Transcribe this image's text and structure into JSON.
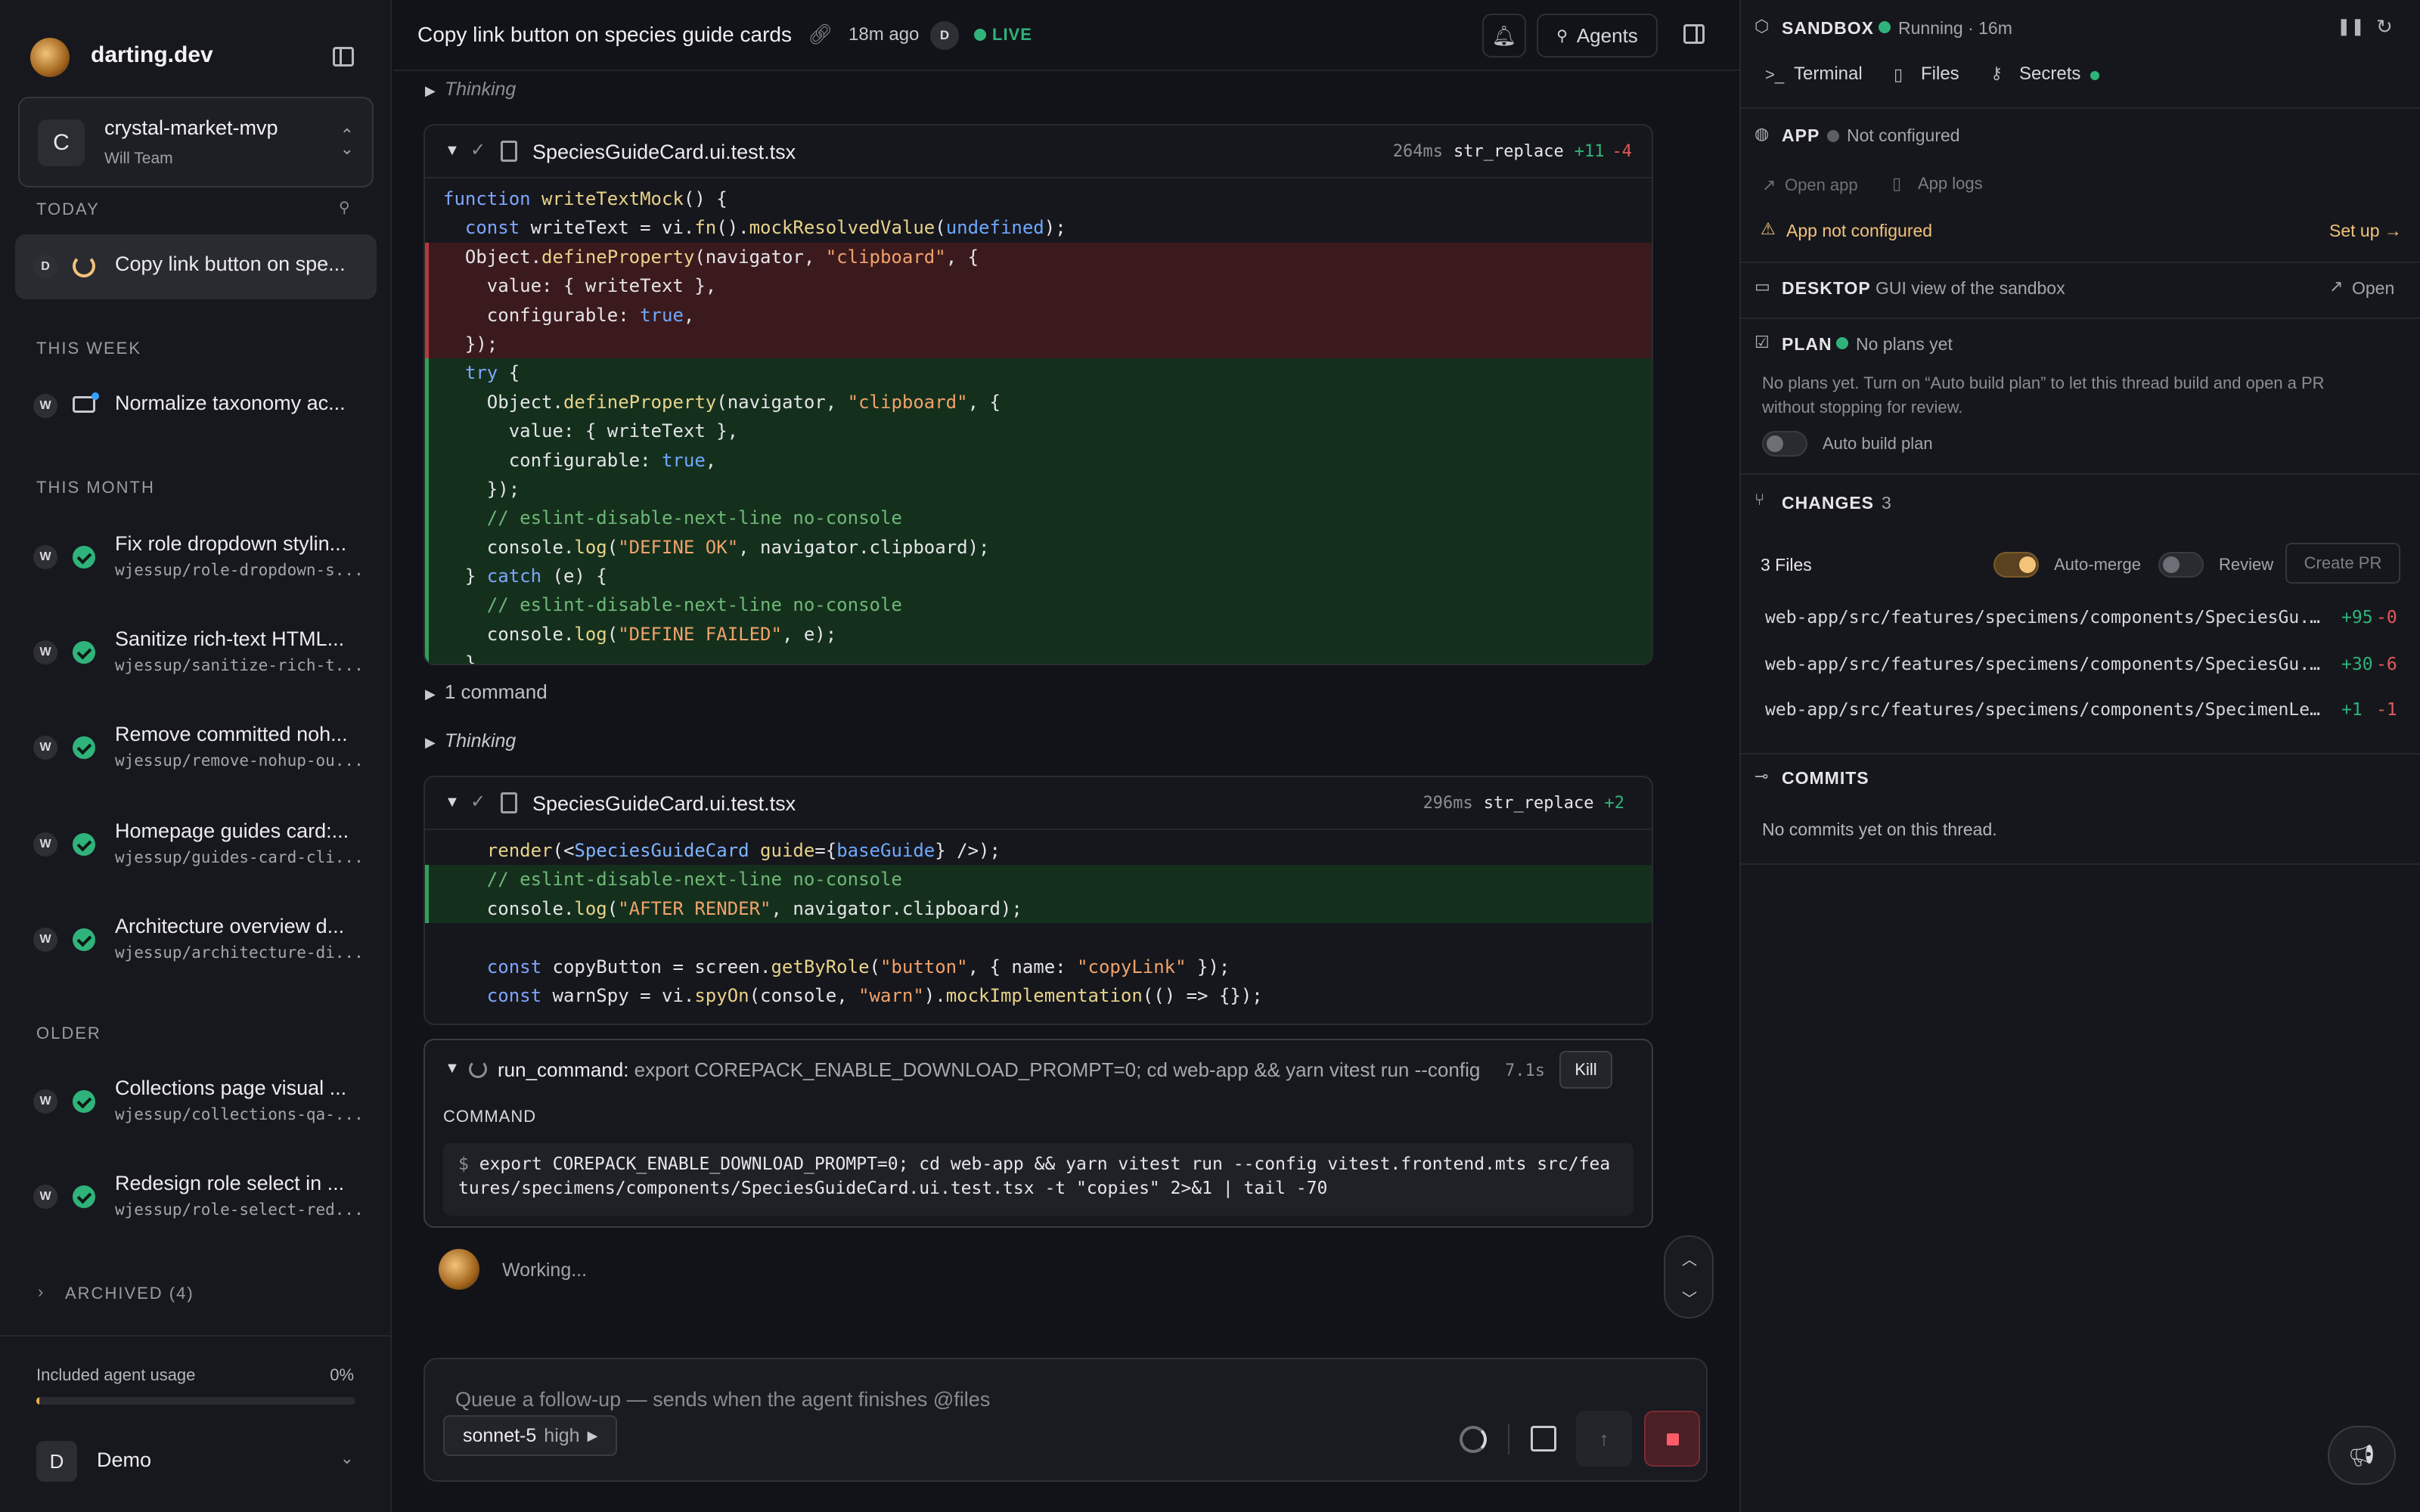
{
  "sidebar": {
    "brand": "darting.dev",
    "project": {
      "avatar": "C",
      "name": "crystal-market-mvp",
      "team": "Will Team"
    },
    "sections": {
      "today": "TODAY",
      "this_week": "THIS WEEK",
      "this_month": "THIS MONTH",
      "older": "OLDER",
      "archived": "ARCHIVED (4)"
    },
    "threads": [
      {
        "avatar": "D",
        "title": "Copy link button on spe...",
        "branch": "",
        "status": "running"
      },
      {
        "avatar": "W",
        "title": "Normalize taxonomy ac...",
        "branch": "",
        "status": "chat"
      },
      {
        "avatar": "W",
        "title": "Fix role dropdown stylin...",
        "branch": "wjessup/role-dropdown-s...",
        "status": "done"
      },
      {
        "avatar": "W",
        "title": "Sanitize rich-text HTML...",
        "branch": "wjessup/sanitize-rich-t...",
        "status": "done"
      },
      {
        "avatar": "W",
        "title": "Remove committed noh...",
        "branch": "wjessup/remove-nohup-ou...",
        "status": "done"
      },
      {
        "avatar": "W",
        "title": "Homepage guides card:...",
        "branch": "wjessup/guides-card-cli...",
        "status": "done"
      },
      {
        "avatar": "W",
        "title": "Architecture overview d...",
        "branch": "wjessup/architecture-di...",
        "status": "done"
      },
      {
        "avatar": "W",
        "title": "Collections page visual ...",
        "branch": "wjessup/collections-qa-...",
        "status": "done"
      },
      {
        "avatar": "W",
        "title": "Redesign role select in ...",
        "branch": "wjessup/role-select-red...",
        "status": "done"
      }
    ],
    "usage": {
      "label": "Included agent usage",
      "percent_text": "0%",
      "fraction": 0.01
    },
    "user": {
      "avatar": "D",
      "name": "Demo"
    }
  },
  "header": {
    "title": "Copy link button on species guide cards",
    "time_ago": "18m ago",
    "user_badge": "D",
    "live": "LIVE",
    "agents_label": "Agents"
  },
  "feed": {
    "thinking_label": "Thinking",
    "command_toggle": "1 command",
    "card1": {
      "file": "SpeciesGuideCard.ui.test.tsx",
      "duration": "264ms",
      "tool": "str_replace",
      "added": "+11",
      "removed": "-4"
    },
    "card2": {
      "file": "SpeciesGuideCard.ui.test.tsx",
      "duration": "296ms",
      "tool": "str_replace",
      "added": "+2"
    },
    "run": {
      "tool": "run_command:",
      "summary": "export COREPACK_ENABLE_DOWNLOAD_PROMPT=0; cd web-app && yarn vitest run --config...",
      "elapsed": "7.1s",
      "kill_label": "Kill",
      "command_label": "COMMAND",
      "prompt": "$",
      "command": "export COREPACK_ENABLE_DOWNLOAD_PROMPT=0; cd web-app && yarn vitest run --config vitest.frontend.mts src/features/specimens/components/SpeciesGuideCard.ui.test.tsx -t \"copies\" 2>&1 | tail -70"
    },
    "working": "Working..."
  },
  "composer": {
    "placeholder": "Queue a follow-up — sends when the agent finishes   @files",
    "model": "sonnet-5",
    "effort": "high"
  },
  "right": {
    "sandbox": {
      "title": "SANDBOX",
      "status": "Running · 16m"
    },
    "tabs": [
      "Terminal",
      "Files",
      "Secrets"
    ],
    "app": {
      "title": "APP",
      "status": "Not configured",
      "open_app": "Open app",
      "app_logs": "App logs",
      "warning": "App not configured",
      "setup": "Set up →"
    },
    "desktop": {
      "title": "DESKTOP",
      "desc": "GUI view of the sandbox",
      "open": "Open"
    },
    "plan": {
      "title": "PLAN",
      "status": "No plans yet",
      "desc_line1": "No plans yet. Turn on “Auto build plan” to let this thread build and open a PR",
      "desc_line2": "without stopping for review.",
      "toggle_label": "Auto build plan"
    },
    "changes": {
      "title": "CHANGES",
      "count": "3",
      "files_label": "3 Files",
      "auto_merge": "Auto-merge",
      "review": "Review",
      "create_pr": "Create PR",
      "files": [
        {
          "path": "web-app/src/features/specimens/components/SpeciesGu...",
          "add": "+95",
          "del": "-0"
        },
        {
          "path": "web-app/src/features/specimens/components/SpeciesGu...",
          "add": "+30",
          "del": "-6"
        },
        {
          "path": "web-app/src/features/specimens/components/SpecimenLe...",
          "add": "+1",
          "del": "-1"
        }
      ]
    },
    "commits": {
      "title": "COMMITS",
      "empty": "No commits yet on this thread."
    }
  },
  "colors": {
    "accent_green": "#2fb37a",
    "accent_amber": "#f2c27a",
    "diff_add_bg": "#14301d",
    "diff_del_bg": "#3b1a1d"
  }
}
